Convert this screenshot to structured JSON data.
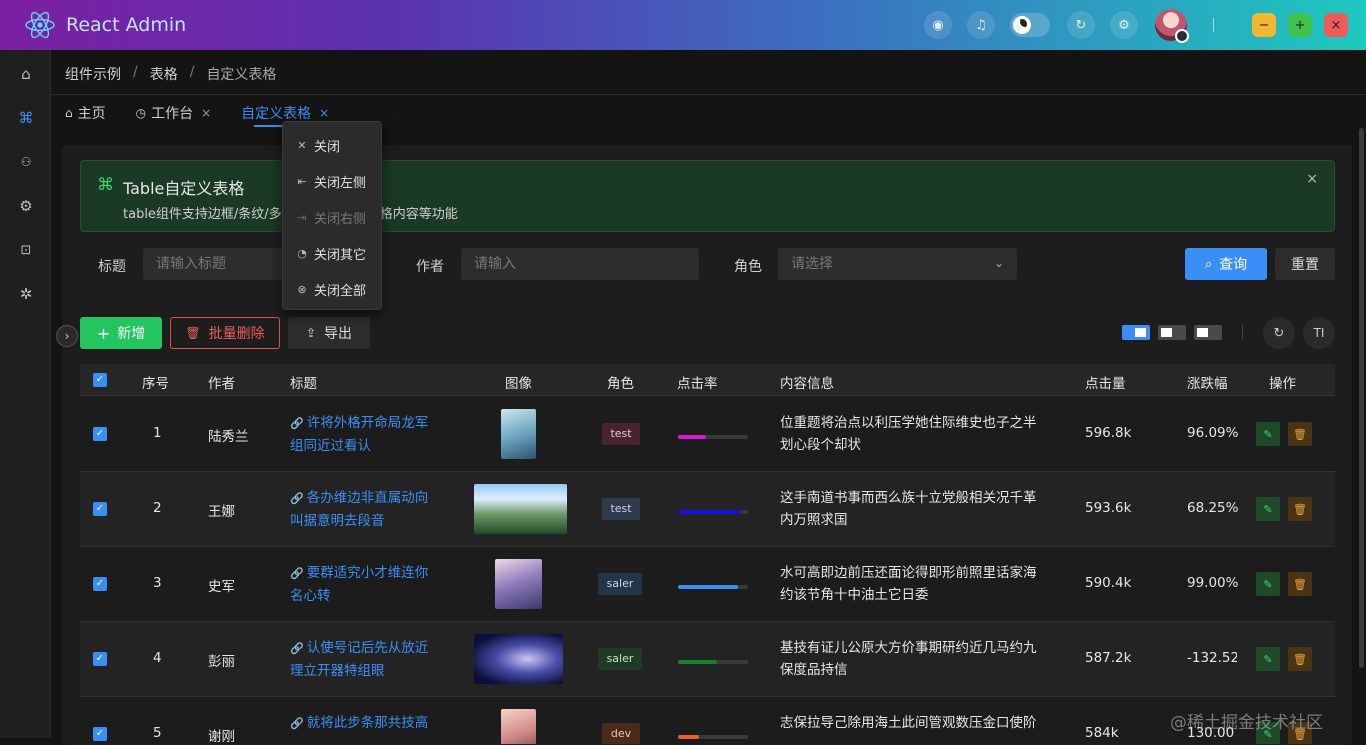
{
  "app": {
    "title": "React Admin"
  },
  "header": {
    "icons": [
      "github-icon",
      "bell-icon",
      "theme-toggle",
      "refresh-icon",
      "settings-icon"
    ],
    "win_min": "−",
    "win_max": "+",
    "win_close": "×"
  },
  "sidebar": {
    "items": [
      {
        "name": "home",
        "icon": "⌂"
      },
      {
        "name": "components",
        "icon": "⌘"
      },
      {
        "name": "users",
        "icon": "👥"
      },
      {
        "name": "settings",
        "icon": "⚙"
      },
      {
        "name": "lock",
        "icon": "🔒"
      },
      {
        "name": "bug",
        "icon": "✲"
      }
    ]
  },
  "breadcrumb": {
    "items": [
      "组件示例",
      "表格",
      "自定义表格"
    ],
    "sep": "/"
  },
  "tabs": [
    {
      "label": "主页",
      "icon": "⌂"
    },
    {
      "label": "工作台",
      "icon": "◷",
      "close": "×"
    },
    {
      "label": "自定义表格",
      "close": "×"
    }
  ],
  "context_menu": {
    "items": [
      {
        "label": "关闭",
        "icon": "✕"
      },
      {
        "label": "关闭左侧",
        "icon": "⇤"
      },
      {
        "label": "关闭右侧",
        "icon": "⇥",
        "disabled": true
      },
      {
        "label": "关闭其它",
        "icon": "◔"
      },
      {
        "label": "关闭全部",
        "icon": "⊗"
      }
    ]
  },
  "alert": {
    "title": "Table自定义表格",
    "desc": "table组件支持边框/条纹/多",
    "desc2": "格内容等功能",
    "close": "×"
  },
  "filters": {
    "title_label": "标题",
    "title_placeholder": "请输入标题",
    "author_label": "作者",
    "author_placeholder": "请输入",
    "role_label": "角色",
    "role_placeholder": "请选择",
    "query": "查询",
    "reset": "重置"
  },
  "toolbar": {
    "add": "新增",
    "batch_delete": "批量删除",
    "export": "导出",
    "font_btn": "TI"
  },
  "table": {
    "columns": [
      "序号",
      "作者",
      "标题",
      "图像",
      "角色",
      "点击率",
      "内容信息",
      "点击量",
      "涨跌幅",
      "操作"
    ],
    "rows": [
      {
        "idx": "1",
        "author": "陆秀兰",
        "title1": "许将外格开命局龙军",
        "title2": "组同近过看认",
        "role": "test",
        "rate": 0.4,
        "rate_color": "#d91bd4",
        "info1": "位重题将治点以利压学她住际维史也子之半",
        "info2": "划心段个却状",
        "clicks": "596.8k",
        "change": "96.09%"
      },
      {
        "idx": "2",
        "author": "王娜",
        "title1": "各办维边非直属动向",
        "title2": "叫据意明去段音",
        "role": "test",
        "rate": 0.9,
        "rate_color": "#1212d8",
        "info1": "这手南道书事而西么族十立党般相关况千革",
        "info2": "内万照求国",
        "clicks": "593.6k",
        "change": "68.25%"
      },
      {
        "idx": "3",
        "author": "史军",
        "title1": "要群适究小才维连你",
        "title2": "名心转",
        "role": "saler",
        "rate": 0.85,
        "rate_color": "#3a8ff7",
        "info1": "水可高即边前压还面论得即形前照里话家海",
        "info2": "约该节角十中油土它日委",
        "clicks": "590.4k",
        "change": "99.00%"
      },
      {
        "idx": "4",
        "author": "彭丽",
        "title1": "认使号记后先从放近",
        "title2": "理立开器特组眼",
        "role": "saler",
        "rate": 0.55,
        "rate_color": "#1a7f2a",
        "info1": "基技有证儿公原大方价事期研约近几马约九",
        "info2": "保度品持信",
        "clicks": "587.2k",
        "change": "-132.52"
      },
      {
        "idx": "5",
        "author": "谢刚",
        "title1": "就将此步条那共技高",
        "title2": "",
        "role": "dev",
        "rate": 0.3,
        "rate_color": "#e8602a",
        "info1": "志保拉导己除用海土此间管观数压金口使阶",
        "info2": "",
        "clicks": "584k",
        "change": "130.00"
      }
    ]
  },
  "watermark": "@稀土掘金技术社区"
}
